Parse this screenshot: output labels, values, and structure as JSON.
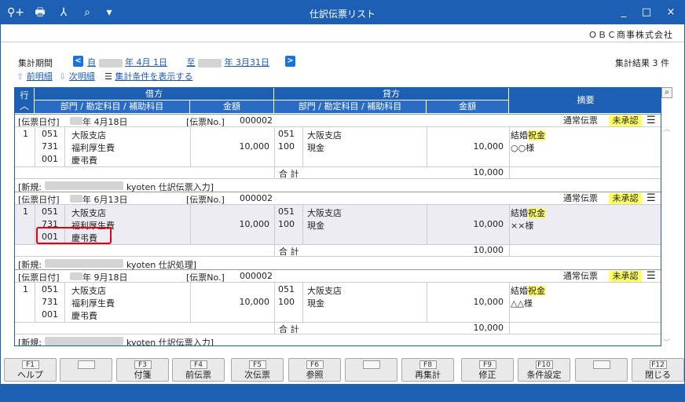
{
  "window": {
    "title": "仕訳伝票リスト",
    "minimize": "_",
    "maximize": "□",
    "close": "×"
  },
  "toolbar": {
    "search_icon": "⚲+",
    "print_icon": "🖶",
    "pdf_icon": "⅄",
    "zoom_icon": "⌕",
    "dropdown_icon": "▾"
  },
  "company": "ＯＢＣ商事株式会社",
  "period": {
    "label": "集計期間",
    "from_prefix": "自",
    "from_suffix": "年  4月 1日",
    "to_prefix": "至",
    "to_suffix": "年  3月31日"
  },
  "result": "集計結果 3 件",
  "subnav": {
    "prev": "前明細",
    "next": "次明細",
    "show_conditions": "集計条件を表示する"
  },
  "grid_header": {
    "row": "行",
    "debit": "借方",
    "credit": "貸方",
    "dept_account": "部門 / 勘定科目 / 補助科目",
    "amount": "金額",
    "summary": "摘要"
  },
  "vouchers": [
    {
      "date_label": "[伝票日付]",
      "date": "年  4月18日",
      "no_label": "[伝票No.]",
      "no": "000002",
      "type": "通常伝票",
      "status": "未承認",
      "row": "1",
      "debit_lines": [
        [
          "051",
          "大阪支店"
        ],
        [
          "731",
          "福利厚生費"
        ],
        [
          "001",
          "慶弔費"
        ]
      ],
      "debit_amount": "10,000",
      "credit_lines": [
        [
          "051",
          "大阪支店"
        ],
        [
          "100",
          "現金"
        ]
      ],
      "credit_amount": "10,000",
      "summary_line1_a": "結婚",
      "summary_line1_b": "祝金",
      "summary_line2": "○○様",
      "total_label": "合  計",
      "total": "10,000",
      "footer_prefix": "[新規:",
      "footer_suffix": "kyoten  仕訳伝票入力]"
    },
    {
      "date_label": "[伝票日付]",
      "date": "年  6月13日",
      "no_label": "[伝票No.]",
      "no": "000002",
      "type": "通常伝票",
      "status": "未承認",
      "row": "1",
      "debit_lines": [
        [
          "051",
          "大阪支店"
        ],
        [
          "731",
          "福利厚生費"
        ],
        [
          "001",
          "慶弔費"
        ]
      ],
      "debit_amount": "10,000",
      "credit_lines": [
        [
          "051",
          "大阪支店"
        ],
        [
          "100",
          "現金"
        ]
      ],
      "credit_amount": "10,000",
      "summary_line1_a": "結婚",
      "summary_line1_b": "祝金",
      "summary_line2": "××様",
      "total_label": "合  計",
      "total": "10,000",
      "footer_prefix": "[新規:",
      "footer_suffix": "kyoten  仕訳処理]"
    },
    {
      "date_label": "[伝票日付]",
      "date": "年  9月18日",
      "no_label": "[伝票No.]",
      "no": "000002",
      "type": "通常伝票",
      "status": "未承認",
      "row": "1",
      "debit_lines": [
        [
          "051",
          "大阪支店"
        ],
        [
          "731",
          "福利厚生費"
        ],
        [
          "001",
          "慶弔費"
        ]
      ],
      "debit_amount": "10,000",
      "credit_lines": [
        [
          "051",
          "大阪支店"
        ],
        [
          "100",
          "現金"
        ]
      ],
      "credit_amount": "10,000",
      "summary_line1_a": "結婚",
      "summary_line1_b": "祝金",
      "summary_line2": "△△様",
      "total_label": "合  計",
      "total": "10,000",
      "footer_prefix": "[新規:",
      "footer_suffix": "kyoten  仕訳伝票入力]"
    }
  ],
  "fkeys": [
    {
      "key": "F1",
      "label": "ヘルプ"
    },
    {
      "key": "",
      "label": ""
    },
    {
      "key": "F3",
      "label": "付箋"
    },
    {
      "key": "F4",
      "label": "前伝票"
    },
    {
      "key": "F5",
      "label": "次伝票"
    },
    {
      "key": "F6",
      "label": "参照"
    },
    {
      "key": "",
      "label": ""
    },
    {
      "key": "F8",
      "label": "再集計"
    },
    {
      "key": "F9",
      "label": "修正"
    },
    {
      "key": "F10",
      "label": "条件設定"
    },
    {
      "key": "",
      "label": ""
    },
    {
      "key": "F12",
      "label": "閉じる"
    }
  ],
  "colors": {
    "accent": "#1d5fb3",
    "highlight": "#ffff66",
    "link": "#1a58b8",
    "alert": "#e60012"
  }
}
